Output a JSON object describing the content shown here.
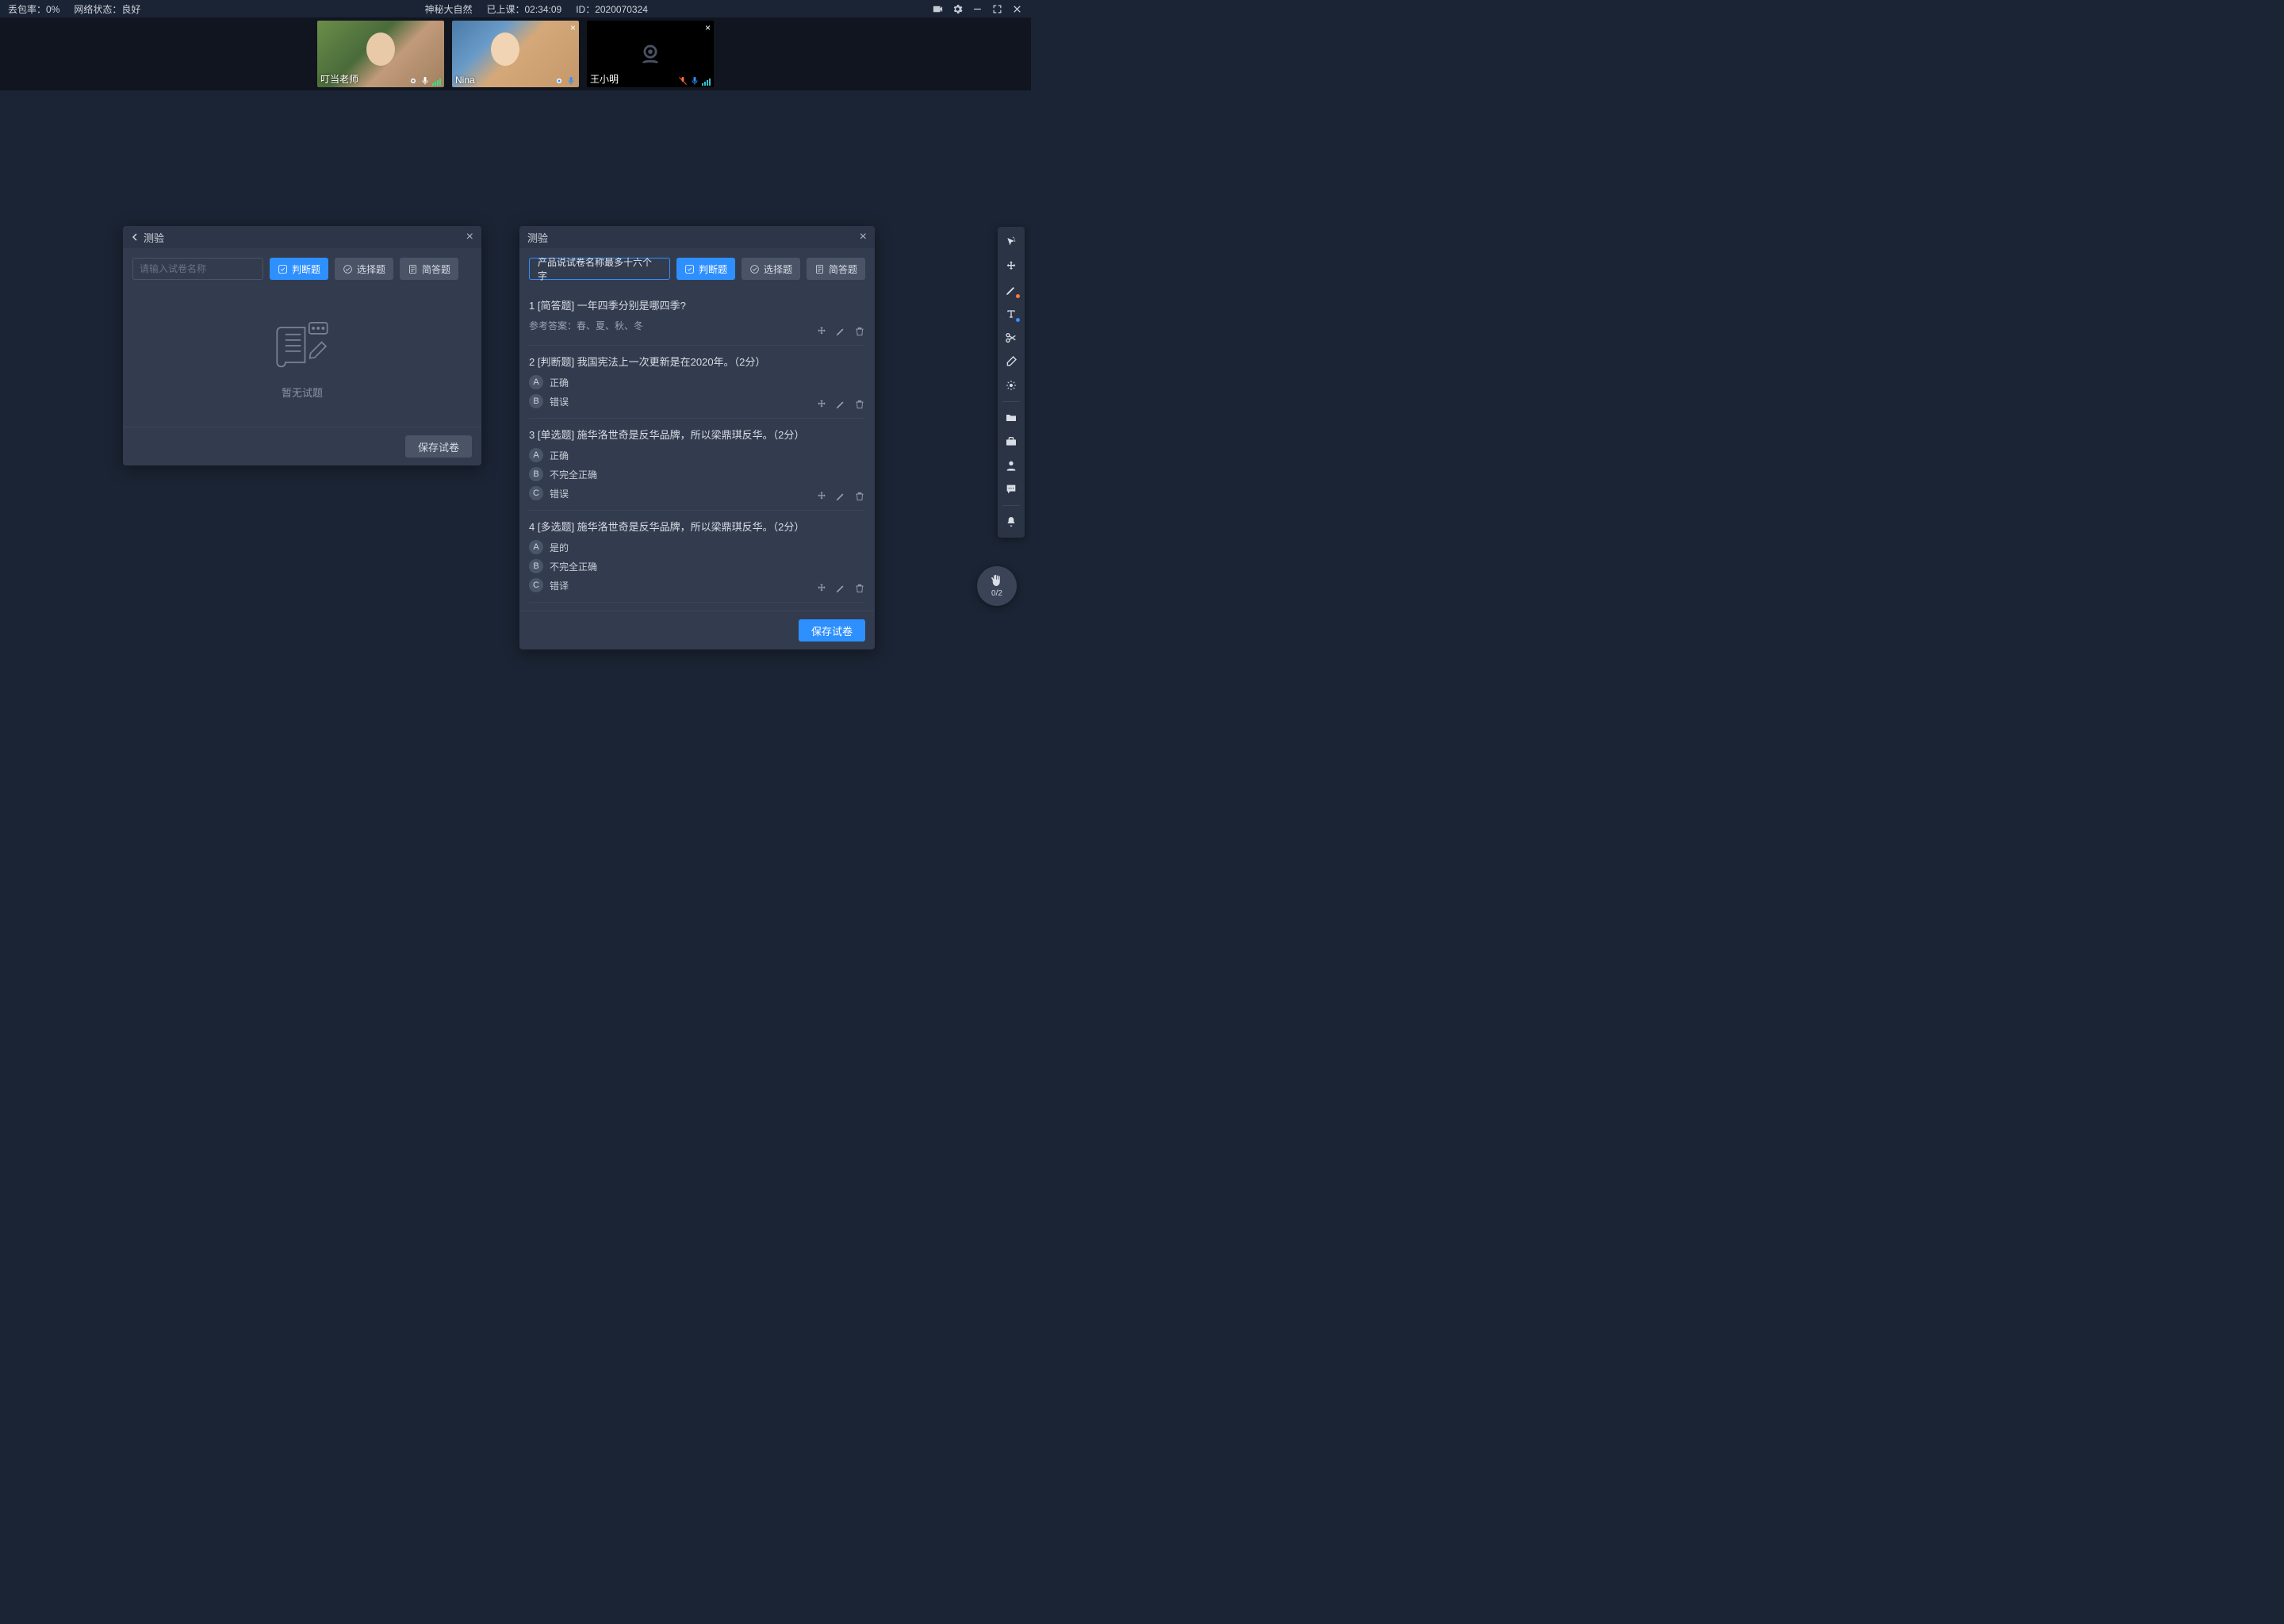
{
  "topbar": {
    "packet_loss_label": "丢包率：",
    "packet_loss_value": "0%",
    "net_label": "网络状态：",
    "net_value": "良好",
    "course_title": "神秘大自然",
    "elapsed_label": "已上课：",
    "elapsed_value": "02:34:09",
    "id_label": "ID：",
    "id_value": "2020070324"
  },
  "videos": [
    {
      "name": "叮当老师",
      "closable": false,
      "cam_on": true
    },
    {
      "name": "Nina",
      "closable": true,
      "cam_on": true
    },
    {
      "name": "王小明",
      "closable": true,
      "cam_on": false
    }
  ],
  "panel1": {
    "title": "测验",
    "search_placeholder": "请输入试卷名称",
    "btn_judge": "判断题",
    "btn_choice": "选择题",
    "btn_short": "简答题",
    "empty_text": "暂无试题",
    "save_label": "保存试卷"
  },
  "panel2": {
    "title": "测验",
    "quiz_name": "产品说试卷名称最多十六个字",
    "btn_judge": "判断题",
    "btn_choice": "选择题",
    "btn_short": "简答题",
    "save_label": "保存试卷",
    "questions": [
      {
        "heading": "1 [简答题] 一年四季分别是哪四季?",
        "answer_label": "参考答案：春、夏、秋、冬",
        "options": []
      },
      {
        "heading": "2 [判断题] 我国宪法上一次更新是在2020年。（2分）",
        "options": [
          {
            "letter": "A",
            "text": "正确"
          },
          {
            "letter": "B",
            "text": "错误"
          }
        ]
      },
      {
        "heading": "3 [单选题] 施华洛世奇是反华品牌，所以梁鼎琪反华。（2分）",
        "options": [
          {
            "letter": "A",
            "text": "正确"
          },
          {
            "letter": "B",
            "text": "不完全正确"
          },
          {
            "letter": "C",
            "text": "错误"
          }
        ]
      },
      {
        "heading": "4 [多选题] 施华洛世奇是反华品牌，所以梁鼎琪反华。（2分）",
        "options": [
          {
            "letter": "A",
            "text": "是的"
          },
          {
            "letter": "B",
            "text": "不完全正确"
          },
          {
            "letter": "C",
            "text": "错译"
          }
        ]
      }
    ]
  },
  "hand_count": "0/2"
}
